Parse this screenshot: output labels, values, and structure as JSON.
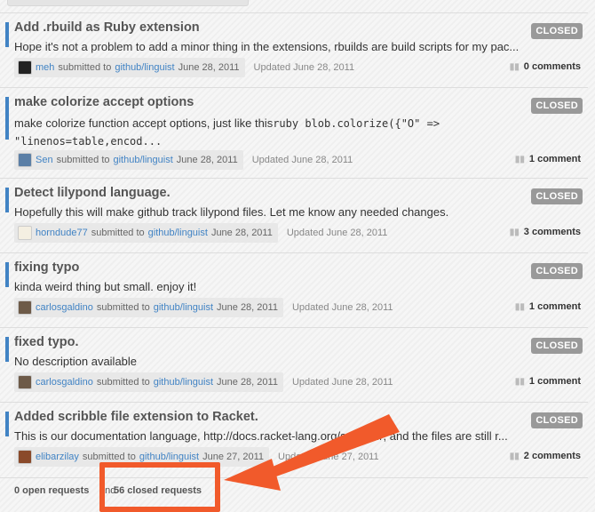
{
  "items": [
    {
      "title": "Add .rbuild as Ruby extension",
      "desc": "Hope it's not a problem to add a minor thing in the extensions, rbuilds are build scripts for my pac...",
      "user": "meh",
      "repo": "github/linguist",
      "submitted_text": "submitted to",
      "date": "June 28, 2011",
      "updated": "Updated June 28, 2011",
      "comments": "0 comments",
      "status": "CLOSED"
    },
    {
      "title": "make colorize accept options",
      "desc_prefix": "make colorize function accept options, just like this",
      "desc_code": "ruby blob.colorize({\"O\" => \"linenos=table,encod...",
      "user": "Sen",
      "repo": "github/linguist",
      "submitted_text": "submitted to",
      "date": "June 28, 2011",
      "updated": "Updated June 28, 2011",
      "comments": "1 comment",
      "status": "CLOSED"
    },
    {
      "title": "Detect lilypond language.",
      "desc": "Hopefully this will make github track lilypond files. Let me know any needed changes.",
      "user": "horndude77",
      "repo": "github/linguist",
      "submitted_text": "submitted to",
      "date": "June 28, 2011",
      "updated": "Updated June 28, 2011",
      "comments": "3 comments",
      "status": "CLOSED"
    },
    {
      "title": "fixing typo",
      "desc": "kinda weird thing but small. enjoy it!",
      "user": "carlosgaldino",
      "repo": "github/linguist",
      "submitted_text": "submitted to",
      "date": "June 28, 2011",
      "updated": "Updated June 28, 2011",
      "comments": "1 comment",
      "status": "CLOSED"
    },
    {
      "title": "fixed typo.",
      "desc": "No description available",
      "user": "carlosgaldino",
      "repo": "github/linguist",
      "submitted_text": "submitted to",
      "date": "June 28, 2011",
      "updated": "Updated June 28, 2011",
      "comments": "1 comment",
      "status": "CLOSED"
    },
    {
      "title": "Added scribble file extension to Racket.",
      "desc": "This is our documentation language, http://docs.racket-lang.org/scribble/, and the files are still r...",
      "user": "elibarzilay",
      "repo": "github/linguist",
      "submitted_text": "submitted to",
      "date": "June 27, 2011",
      "updated": "Updated June 27, 2011",
      "comments": "2 comments",
      "status": "CLOSED"
    }
  ],
  "footer": {
    "open": "0 open requests",
    "and": "and",
    "closed": "56 closed requests"
  },
  "colors": {
    "accent": "#4183c4",
    "annotation": "#f15a2b",
    "badge": "#999999"
  },
  "icons": {
    "comment": "comment-icon"
  }
}
